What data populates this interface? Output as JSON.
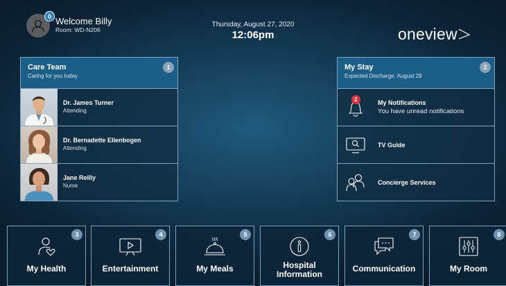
{
  "header": {
    "welcome": "Welcome Billy",
    "room": "Room: WD-N206",
    "avatar_badge": "0",
    "date": "Thursday, August 27, 2020",
    "time": "12:06pm",
    "logo": "oneview"
  },
  "care_team": {
    "title": "Care Team",
    "subtitle": "Caring for you today",
    "badge": "1",
    "members": [
      {
        "name": "Dr. James Turner",
        "role": "Attending"
      },
      {
        "name": "Dr. Bernadette Ellenbogen",
        "role": "Attending"
      },
      {
        "name": "Jane Reilly",
        "role": "Nurse"
      }
    ]
  },
  "my_stay": {
    "title": "My Stay",
    "subtitle": "Expected Discharge: August 29",
    "badge": "2",
    "notifications": {
      "title": "My Notifications",
      "subtitle": "You have unread notifications",
      "count": "2"
    },
    "tv_guide": "TV Guide",
    "concierge": "Concierge Services"
  },
  "tiles": [
    {
      "label": "My Health",
      "badge": "3",
      "icon": "health-icon"
    },
    {
      "label": "Entertainment",
      "badge": "4",
      "icon": "play-screen-icon"
    },
    {
      "label": "My Meals",
      "badge": "5",
      "icon": "cloche-icon"
    },
    {
      "label": "Hospital Information",
      "badge": "6",
      "icon": "info-icon"
    },
    {
      "label": "Communication",
      "badge": "7",
      "icon": "chat-icon"
    },
    {
      "label": "My Room",
      "badge": "8",
      "icon": "sliders-icon"
    }
  ],
  "colors": {
    "header_blue": "#1b5e87",
    "notification_red": "#d6333b",
    "badge_gray": "#8aa3b8"
  }
}
